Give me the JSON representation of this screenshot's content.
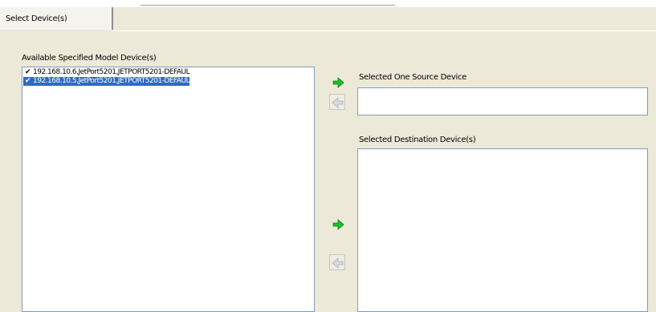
{
  "tabs": [
    {
      "label": "Select Device(s)"
    }
  ],
  "available": {
    "label": "Available Specified Model Device(s)",
    "items": [
      {
        "checked": true,
        "text": "192.168.10.6,JetPort5201,JETPORT5201-DEFAUL",
        "selected": false
      },
      {
        "checked": true,
        "text": "192.168.10.5,JetPort5201,JETPORT5201-DEFAUL",
        "selected": true
      }
    ]
  },
  "source": {
    "label": "Selected One Source Device",
    "value": ""
  },
  "destination": {
    "label": "Selected Destination Device(s)",
    "items": []
  },
  "icons": {
    "add": "arrow-right-icon",
    "remove": "arrow-left-icon"
  },
  "colors": {
    "selection": "#316ac5",
    "add_arrow": "#19c22a",
    "remove_arrow_disabled": "#a9b0b8"
  }
}
